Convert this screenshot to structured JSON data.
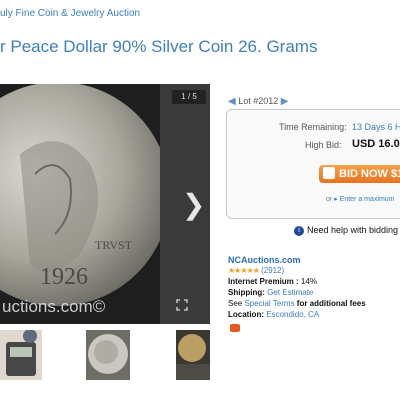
{
  "breadcrumb": "uly Fine Coin & Jewelry Auction",
  "title": "r Peace Dollar 90% Silver Coin 26. Grams",
  "viewer": {
    "counter": "1 / 5",
    "coin_date_text": "1926",
    "trust_text": "TRVST",
    "watermark": "uctions.com©"
  },
  "lot": {
    "number": "Lot #2012"
  },
  "bid": {
    "time_label": "Time Remaining:",
    "time_value": "13 Days 6 H",
    "high_bid_label": "High Bid:",
    "high_bid_value": "USD 16.0",
    "button_label": "BID NOW $1",
    "or_text": "or",
    "max_link": "Enter a maximum"
  },
  "help": {
    "text": "Need help with bidding"
  },
  "seller": {
    "name": "NCAuctions.com",
    "rating_count": "(2912)",
    "premium_label": "Internet Premium :",
    "premium_value": "14%",
    "shipping_label": "Shipping:",
    "shipping_link": "Get Estimate",
    "see_text": "See",
    "terms_link": "Special Terms",
    "fees_text": "for additional fees",
    "location_label": "Location:",
    "location_value": "Escondido, CA"
  },
  "colors": {
    "link": "#3a7dc0",
    "bid_button": "#e8731e",
    "stars": "#f0a020"
  }
}
